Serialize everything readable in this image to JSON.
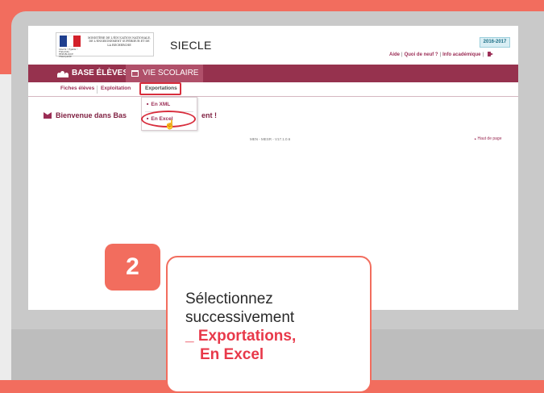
{
  "app": {
    "title": "SIECLE",
    "ministry_lines": "MINISTÈRE DE L'ÉDUCATION NATIONALE, DE L'ENSEIGNEMENT SUPÉRIEUR ET DE LA RECHERCHE",
    "flag_caption": "Liberté • Égalité • Fraternité RÉPUBLIQUE FRANÇAISE",
    "year": "2016-2017"
  },
  "toplinks": {
    "aide": "Aide",
    "quoi_de_neuf": "Quoi de neuf ?",
    "info": "Info académique"
  },
  "nav": {
    "base_eleves": "BASE ÉLÈVES",
    "vie_scolaire": "VIE SCOLAIRE"
  },
  "subnav": {
    "fiches": "Fiches élèves",
    "exploitation": "Exploitation",
    "exportations": "Exportations"
  },
  "dropdown": {
    "xml": "En XML",
    "excel": "En Excel"
  },
  "main": {
    "welcome_start": "Bienvenue dans Bas",
    "welcome_end": "ent !",
    "version": "MEN - MESR - V17.1.0.6",
    "page_top": "Haut de page"
  },
  "callout": {
    "step_number": "2",
    "line1": "Sélectionnez",
    "line2": "successivement",
    "highlight1": "_ Exportations,",
    "highlight2": "En Excel"
  },
  "colors": {
    "accent": "#f26d5e",
    "nav_bar": "#96324e",
    "highlight_red": "#d82e3d",
    "callout_red": "#e8394a"
  }
}
